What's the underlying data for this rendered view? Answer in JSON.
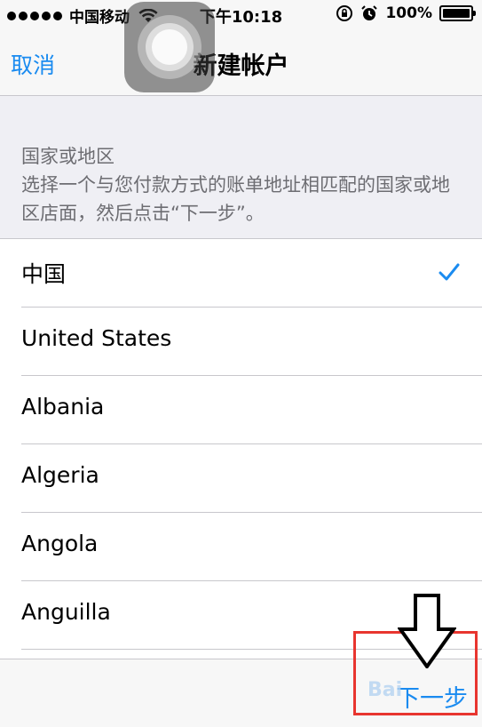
{
  "status_bar": {
    "carrier": "中国移动",
    "time": "下午10:18",
    "battery": "100%"
  },
  "nav": {
    "cancel_label": "取消",
    "title": "新建帐户"
  },
  "section": {
    "header": "国家或地区",
    "description": "选择一个与您付款方式的账单地址相匹配的国家或地区店面，然后点击“下一步”。"
  },
  "countries": [
    {
      "name": "中国",
      "selected": true
    },
    {
      "name": "United States",
      "selected": false
    },
    {
      "name": "Albania",
      "selected": false
    },
    {
      "name": "Algeria",
      "selected": false
    },
    {
      "name": "Angola",
      "selected": false
    },
    {
      "name": "Anguilla",
      "selected": false
    }
  ],
  "toolbar": {
    "next_label": "下一步"
  },
  "watermark": "Bai",
  "colors": {
    "accent": "#1a8bf0",
    "annotation": "#e8352f"
  }
}
